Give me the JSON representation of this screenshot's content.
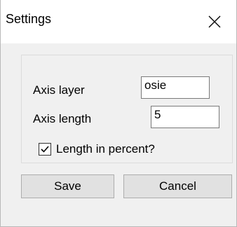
{
  "window": {
    "title": "Settings"
  },
  "fields": {
    "axis_layer": {
      "label": "Axis layer",
      "value": "osie"
    },
    "axis_length": {
      "label": "Axis length",
      "value": "5"
    }
  },
  "checkbox": {
    "label": "Length in percent?",
    "checked": true
  },
  "buttons": {
    "save": "Save",
    "cancel": "Cancel"
  },
  "icons": {
    "close": "close-icon",
    "check": "checkmark-icon"
  }
}
